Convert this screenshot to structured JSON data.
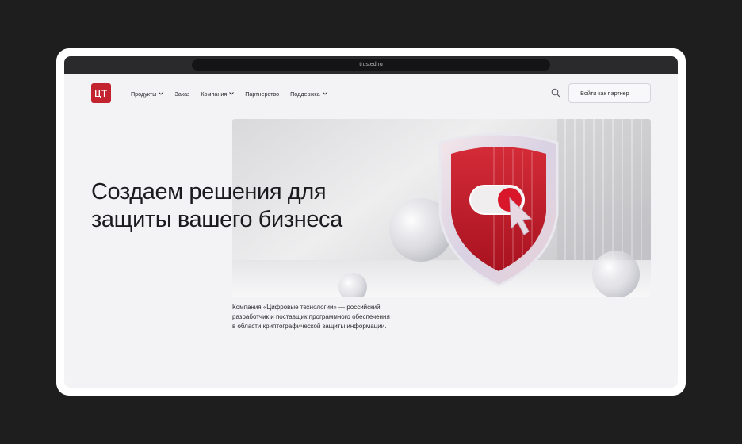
{
  "browser": {
    "url": "trusted.ru"
  },
  "logo": {
    "text": "ЦТ"
  },
  "nav": {
    "items": [
      {
        "label": "Продукты",
        "has_dropdown": true
      },
      {
        "label": "Заказ",
        "has_dropdown": false
      },
      {
        "label": "Компания",
        "has_dropdown": true
      },
      {
        "label": "Партнерство",
        "has_dropdown": false
      },
      {
        "label": "Поддержка",
        "has_dropdown": true
      }
    ]
  },
  "header": {
    "partner_button_label": "Войти как партнер",
    "partner_button_arrow": "→"
  },
  "hero": {
    "headline_line1": "Создаем решения для",
    "headline_line2": "защиты вашего бизнеса",
    "description_line1": "Компания «Цифровые технологии» — российский",
    "description_line2": "разработчик и поставщик программного обеспечения",
    "description_line3": "в области криптографической защиты информации."
  },
  "colors": {
    "brand_red": "#c3222f",
    "page_bg": "#f3f3f6",
    "outer_bg": "#1e1e1e",
    "text": "#1b1b1f"
  },
  "icons": [
    "search-icon",
    "chevron-down-icon",
    "arrow-right-icon",
    "shield-icon",
    "cursor-icon"
  ]
}
